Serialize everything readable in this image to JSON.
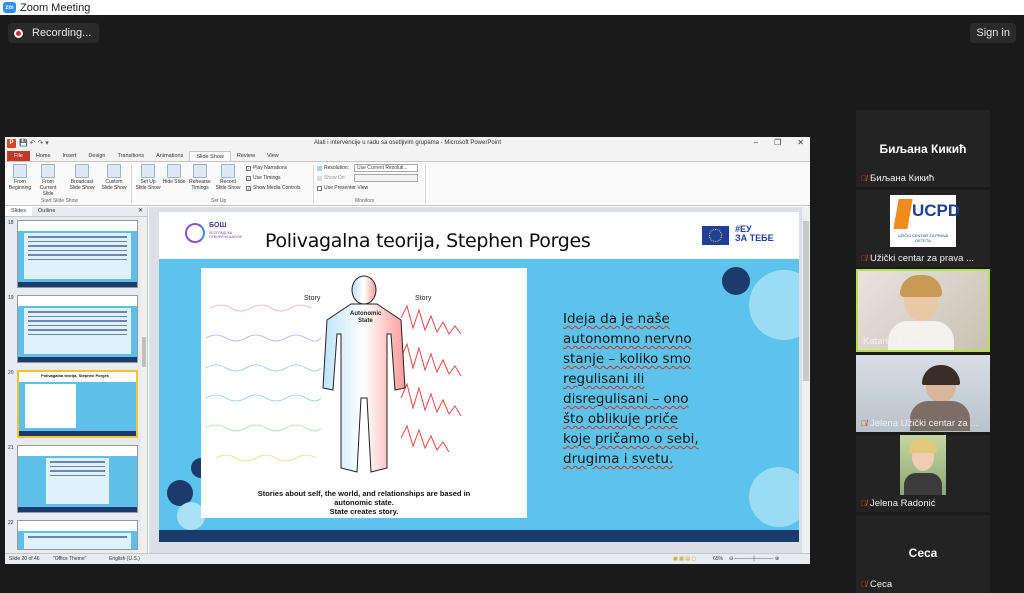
{
  "zoom": {
    "window_title": "Zoom Meeting",
    "logo_text": "zm",
    "recording_label": "Recording...",
    "signin_label": "Sign in"
  },
  "ppt": {
    "window_title": "Alati i intervencije u radu sa osetljivim grupama - Microsoft PowerPoint",
    "tabs": [
      "File",
      "Home",
      "Insert",
      "Design",
      "Transitions",
      "Animations",
      "Slide Show",
      "Review",
      "View"
    ],
    "active_tab": "Slide Show",
    "ribbon": {
      "from_beginning": "From Beginning",
      "from_current": "From Current Slide",
      "broadcast": "Broadcast Slide Show",
      "custom": "Custom Slide Show",
      "group_start": "Start Slide Show",
      "setup_show": "Set Up Slide Show",
      "hide_slide": "Hide Slide",
      "rehearse": "Rehearse Timings",
      "record": "Record Slide Show",
      "play_narrations": "Play Narrations",
      "use_timings": "Use Timings",
      "show_media_controls": "Show Media Controls",
      "group_setup": "Set Up",
      "resolution_label": "Resolution:",
      "resolution_value": "Use Current Resoluti...",
      "show_on_label": "Show On:",
      "use_presenter_view": "Use Presenter View",
      "group_monitors": "Monitors"
    },
    "panel_tabs": [
      "Slides",
      "Outline"
    ],
    "thumbnails": [
      {
        "num": "18",
        "title": ""
      },
      {
        "num": "19",
        "title": ""
      },
      {
        "num": "20",
        "title": "Polivagalna teorija, Stephen Porges"
      },
      {
        "num": "21",
        "title": ""
      },
      {
        "num": "22",
        "title": ""
      }
    ],
    "status": {
      "slide_info": "Slide 20 of 46",
      "theme": "\"Office Theme\"",
      "language": "English (U.S.)",
      "zoom": "65%"
    }
  },
  "slide": {
    "title": "Polivagalna teorija, Stephen Porges",
    "logo_text": "БОШ",
    "logo_subtext": "БЕОГРАДСКА ОТВОРЕНА ШКОЛА",
    "eu_text_line1": "#ЕУ",
    "eu_text_line2": "ЗА ТЕБЕ",
    "figure": {
      "story_left": "Story",
      "story_right": "Story",
      "center_label_1": "Autonomic",
      "center_label_2": "State",
      "caption_line1": "Stories about self, the world, and relationships are based in",
      "caption_line2": "autonomic state.",
      "caption_line3": "State creates story."
    },
    "body_lines": [
      "Ideja da je naše",
      "autonomno nervno",
      "stanje – koliko smo",
      "regulisani ili",
      "disregulisani – ono",
      "što oblikuje priče",
      "koje pričamo o sebi,",
      "drugima i svetu."
    ]
  },
  "participants": [
    {
      "name": "Биљана Кикић",
      "big_label": "Биљана Кикић",
      "muted": true
    },
    {
      "name": "Užički centar za prava ...",
      "logo": "UCPD",
      "logo_sub": "UŽIČKI CENTAR ZA PRAVA DETETA",
      "muted": true
    },
    {
      "name": "Katarina Majkic",
      "muted": false,
      "active": true
    },
    {
      "name": "Jelena Užički centar za ...",
      "muted": true
    },
    {
      "name": "Jelena Radonić",
      "muted": true
    },
    {
      "name": "Ceca",
      "big_label": "Ceca",
      "muted": true
    }
  ],
  "colors": {
    "slide_bg": "#5cc4ec",
    "slide_bar": "#1a3b6b",
    "ppt_file_tab": "#c5392b",
    "active_speaker": "#b8e04a",
    "mic_muted": "#e43a3a"
  }
}
